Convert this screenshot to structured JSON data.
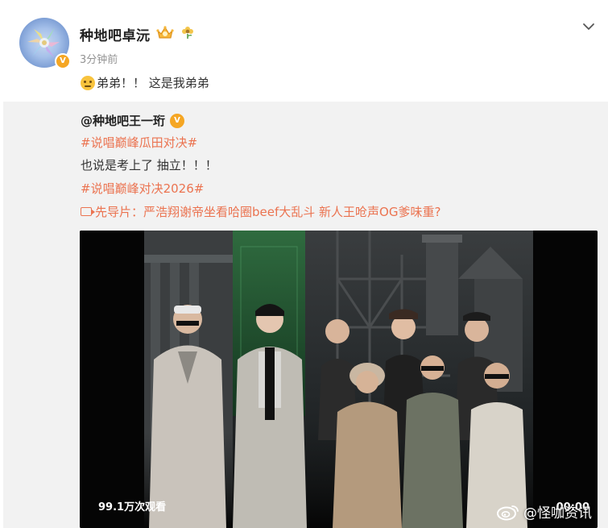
{
  "post": {
    "username": "种地吧卓沅",
    "timestamp": "3分钟前",
    "text": "弟弟！！ 这是我弟弟"
  },
  "repost": {
    "author": "@种地吧王一珩",
    "lines": [
      {
        "kind": "hashtag",
        "text": "#说唱巅峰瓜田对决#"
      },
      {
        "kind": "plain",
        "text": "也说是考上了 抽立！！！"
      },
      {
        "kind": "hashtag",
        "text": "#说唱巅峰对决2026#"
      }
    ],
    "video_link_text": "先导片：严浩翔谢帝坐看哈圈beef大乱斗 新人王呛声OG爹味重?"
  },
  "video": {
    "views": "99.1万次观看",
    "duration": "00:00"
  },
  "watermark": "@怪咖资讯",
  "colors": {
    "link": "#eb7350",
    "verified": "#f5a623",
    "repost_bg": "#f2f2f2"
  },
  "icons": {
    "verified": "verified-v-icon",
    "chevron": "chevron-down-icon",
    "video_link": "video-link-icon",
    "weibo": "weibo-logo-icon"
  }
}
